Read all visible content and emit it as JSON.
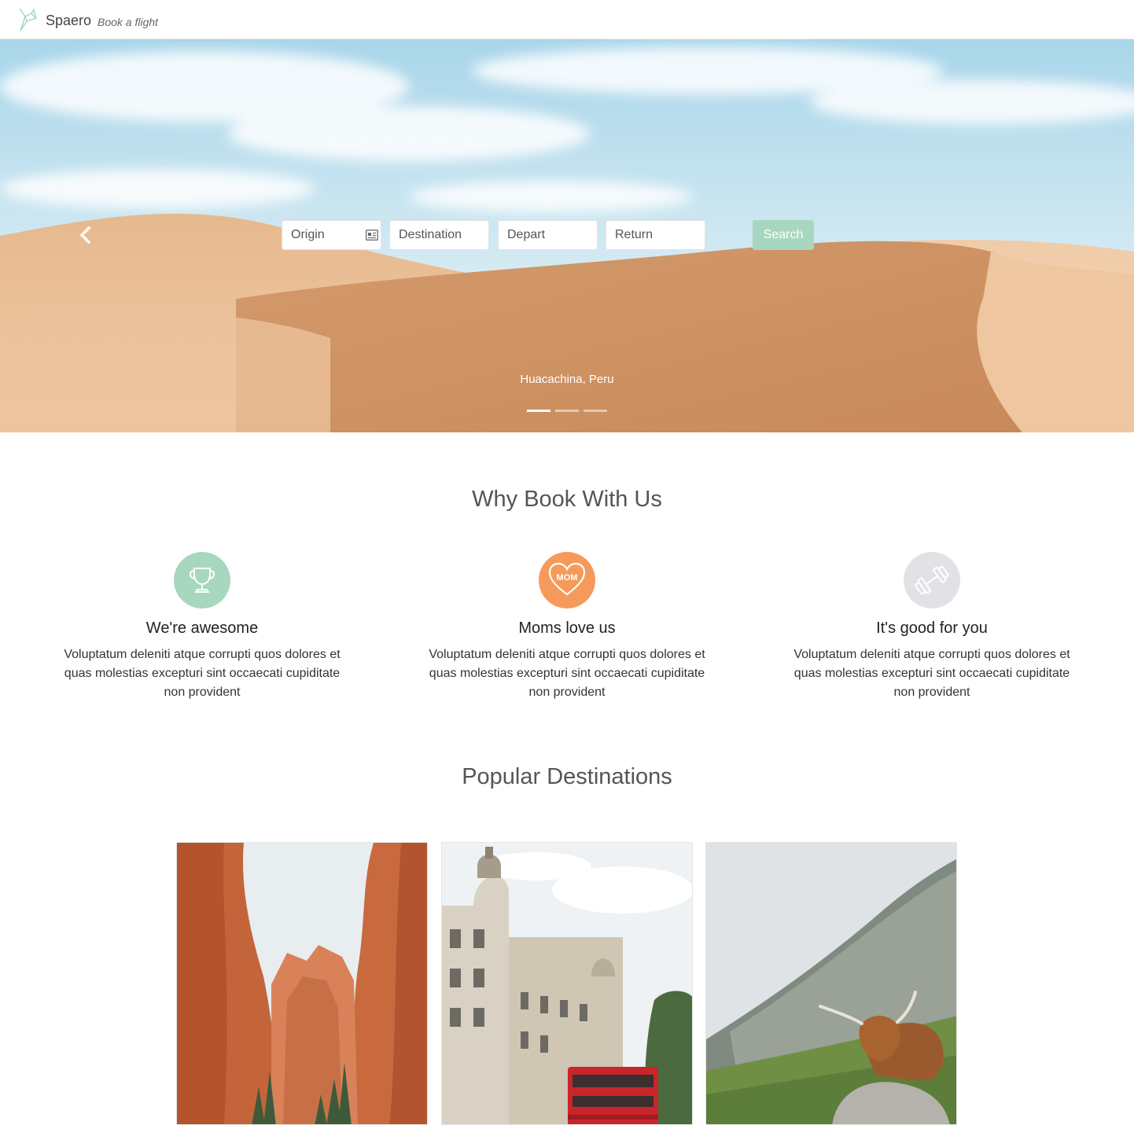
{
  "navbar": {
    "brand": "Spaero",
    "tagline": "Book a flight",
    "logo_icon": "origami-bird-icon",
    "accent": "#a8d7bf"
  },
  "hero": {
    "form": {
      "origin_placeholder": "Origin",
      "origin_icon": "address-card-icon",
      "destination_placeholder": "Destination",
      "depart_placeholder": "Depart",
      "return_placeholder": "Return",
      "search_label": "Search"
    },
    "caption": "Huacachina, Peru",
    "prev_icon": "chevron-left-icon",
    "slides": {
      "count": 3,
      "active": 1
    }
  },
  "why": {
    "title": "Why Book With Us",
    "features": [
      {
        "icon": "trophy-icon",
        "icon_bg": "#a8d7bf",
        "heading": "We're awesome",
        "text": "Voluptatum deleniti atque corrupti quos dolores et quas molestias excepturi sint occaecati cupiditate non provident"
      },
      {
        "icon": "mom-heart-icon",
        "icon_bg": "#f59a5b",
        "heading": "Moms love us",
        "text": "Voluptatum deleniti atque corrupti quos dolores et quas molestias excepturi sint occaecati cupiditate non provident",
        "icon_text": "MOM"
      },
      {
        "icon": "dumbbell-icon",
        "icon_bg": "#e2e2e6",
        "heading": "It's good for you",
        "text": "Voluptatum deleniti atque corrupti quos dolores et quas molestias excepturi sint occaecati cupiditate non provident"
      }
    ]
  },
  "popular": {
    "title": "Popular Destinations",
    "cards": [
      {
        "image": "red-rock-canyon-photo"
      },
      {
        "image": "london-building-red-bus-photo"
      },
      {
        "image": "highland-cow-mountain-photo"
      }
    ]
  }
}
